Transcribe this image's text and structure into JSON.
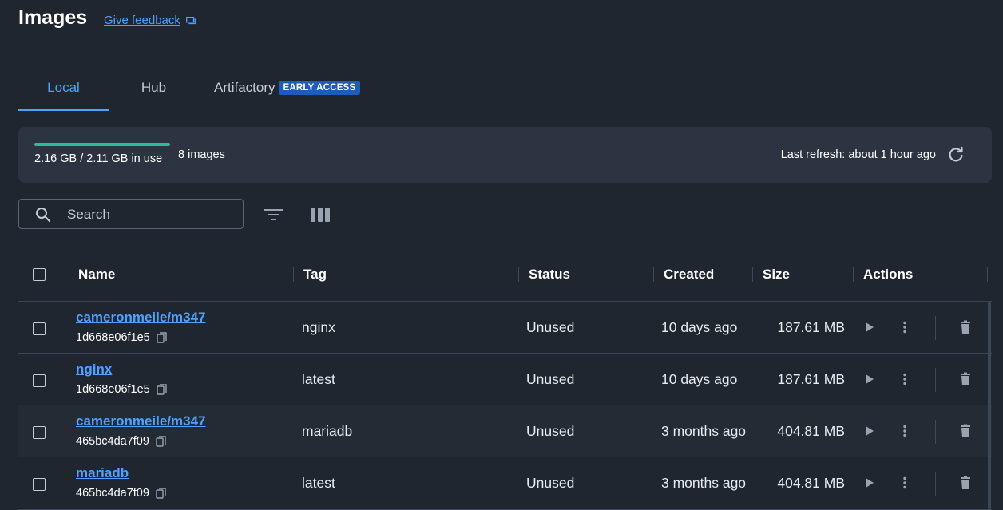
{
  "header": {
    "title": "Images",
    "feedback_label": "Give feedback"
  },
  "tabs": [
    {
      "label": "Local",
      "active": true
    },
    {
      "label": "Hub",
      "active": false
    },
    {
      "label": "Artifactory",
      "badge": "EARLY ACCESS",
      "active": false
    }
  ],
  "usage": {
    "text": "2.16 GB / 2.11 GB in use",
    "image_count": "8 images",
    "fill_fraction": 1.0,
    "last_refresh": "Last refresh: about 1 hour ago"
  },
  "search": {
    "placeholder": "Search",
    "value": ""
  },
  "table": {
    "columns": [
      "Name",
      "Tag",
      "Status",
      "Created",
      "Size",
      "Actions"
    ],
    "rows": [
      {
        "name": "cameronmeile/m347",
        "id": "1d668e06f1e5",
        "tag": "nginx",
        "status": "Unused",
        "created": "10 days ago",
        "size": "187.61 MB"
      },
      {
        "name": "nginx",
        "id": "1d668e06f1e5",
        "tag": "latest",
        "status": "Unused",
        "created": "10 days ago",
        "size": "187.61 MB"
      },
      {
        "name": "cameronmeile/m347",
        "id": "465bc4da7f09",
        "tag": "mariadb",
        "status": "Unused",
        "created": "3 months ago",
        "size": "404.81 MB"
      },
      {
        "name": "mariadb",
        "id": "465bc4da7f09",
        "tag": "latest",
        "status": "Unused",
        "created": "3 months ago",
        "size": "404.81 MB"
      }
    ]
  },
  "icons": {
    "feedback": "feedback-icon",
    "refresh": "refresh-icon",
    "search": "search-icon",
    "filter": "filter-icon",
    "columns": "columns-icon",
    "copy": "copy-icon",
    "run": "play-icon",
    "more": "more-vertical-icon",
    "delete": "trash-icon"
  },
  "colors": {
    "accent": "#4ea1ff",
    "usage_fill": "#2bbd9b",
    "badge_bg": "#1f5bb8",
    "background": "#1f262f"
  }
}
